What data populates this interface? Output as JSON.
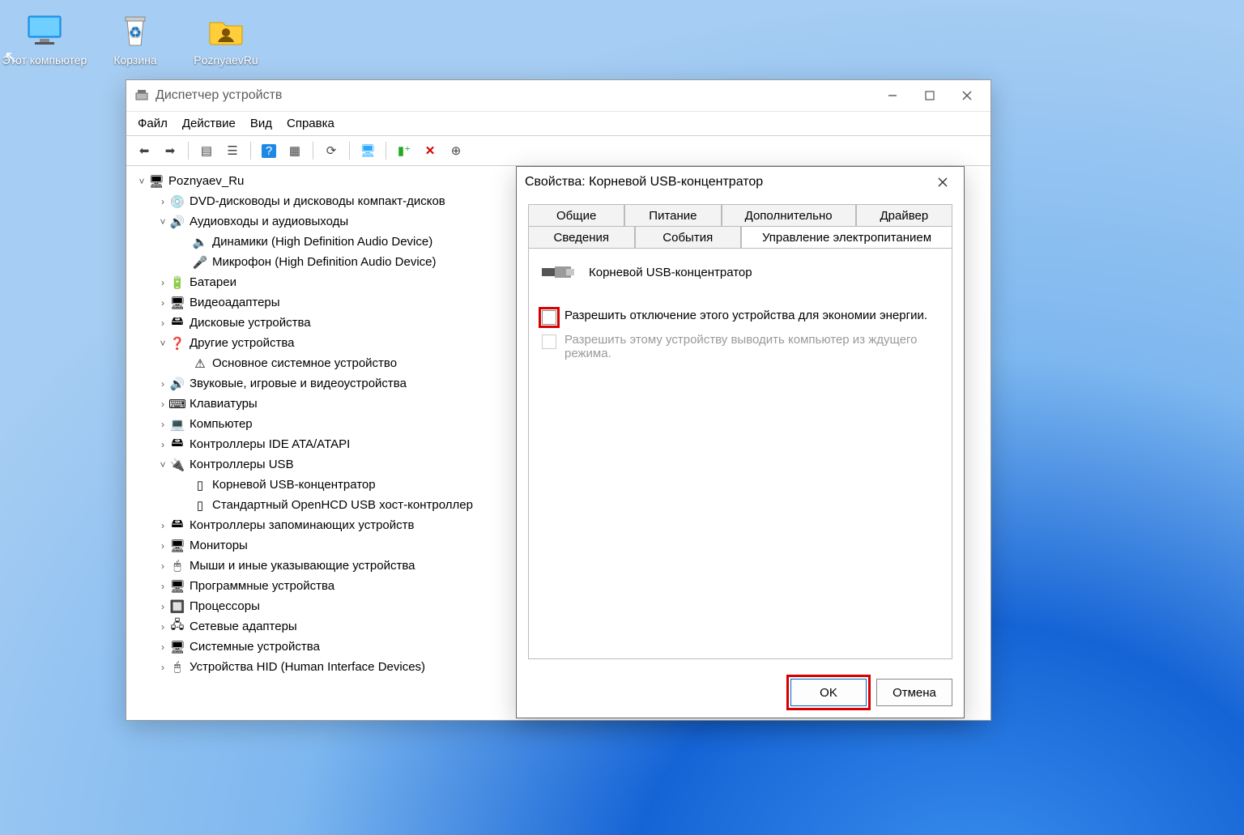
{
  "desktop": {
    "this_pc": "Этот компьютер",
    "recycle": "Корзина",
    "folder": "PoznyaevRu"
  },
  "devmgr": {
    "title": "Диспетчер устройств",
    "menu": {
      "file": "Файл",
      "action": "Действие",
      "view": "Вид",
      "help": "Справка"
    },
    "tree": {
      "root": "Poznyaev_Ru",
      "dvd": "DVD-дисководы и дисководы компакт-дисков",
      "audio": "Аудиовходы и аудиовыходы",
      "audio_spk": "Динамики (High Definition Audio Device)",
      "audio_mic": "Микрофон (High Definition Audio Device)",
      "battery": "Батареи",
      "video": "Видеоадаптеры",
      "disk": "Дисковые устройства",
      "other": "Другие устройства",
      "other_base": "Основное системное устройство",
      "sound": "Звуковые, игровые и видеоустройства",
      "keyboard": "Клавиатуры",
      "computer": "Компьютер",
      "ide": "Контроллеры IDE ATA/ATAPI",
      "usb": "Контроллеры USB",
      "usb_root": "Корневой USB-концентратор",
      "usb_host": "Стандартный OpenHCD USB хост-контроллер",
      "storage": "Контроллеры запоминающих устройств",
      "monitor": "Мониторы",
      "mouse": "Мыши и иные указывающие устройства",
      "software": "Программные устройства",
      "cpu": "Процессоры",
      "net": "Сетевые адаптеры",
      "system": "Системные устройства",
      "hid": "Устройства HID (Human Interface Devices)"
    }
  },
  "props": {
    "title": "Свойства: Корневой USB-концентратор",
    "tabs": {
      "general": "Общие",
      "power": "Питание",
      "advanced": "Дополнительно",
      "driver": "Драйвер",
      "details": "Сведения",
      "events": "События",
      "pm": "Управление электропитанием"
    },
    "device_name": "Корневой USB-концентратор",
    "chk_allow_off": "Разрешить отключение этого устройства для экономии энергии.",
    "chk_allow_wake": "Разрешить этому устройству выводить компьютер из ждущего режима.",
    "ok": "OK",
    "cancel": "Отмена"
  }
}
